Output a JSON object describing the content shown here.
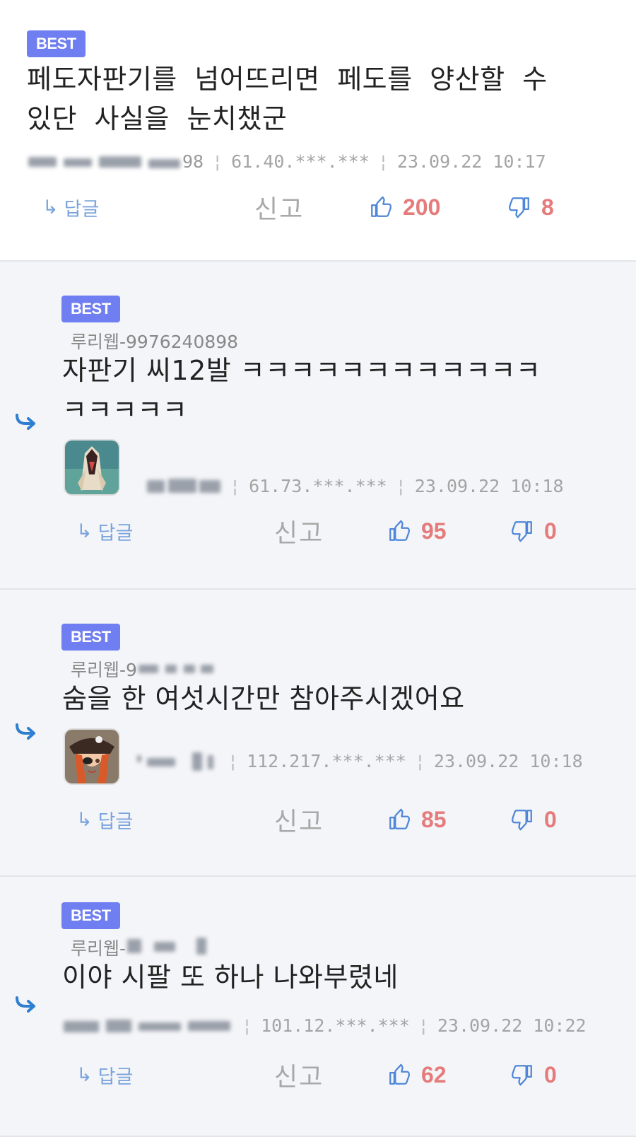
{
  "comments": [
    {
      "badge": "BEST",
      "text_lines": [
        "페도자판기를 넘어뜨리면 페도를 양산할 수",
        "있단 사실을 눈치챘군"
      ],
      "nick_visible": "98",
      "ip": "61.40.***.***",
      "datetime": "23.09.22 10:17",
      "reply_label": "답글",
      "report_label": "신고",
      "likes": "200",
      "dislikes": "8"
    },
    {
      "badge": "BEST",
      "nick": "루리웹-9976240898",
      "text_lines": [
        "자판기 씨12발 ㅋㅋㅋㅋㅋㅋㅋㅋㅋㅋㅋㅋ",
        "ㅋㅋㅋㅋㅋ"
      ],
      "ip": "61.73.***.***",
      "datetime": "23.09.22 10:18",
      "reply_label": "답글",
      "report_label": "신고",
      "likes": "95",
      "dislikes": "0"
    },
    {
      "badge": "BEST",
      "nick": "루리웹-9",
      "text_lines": [
        "숨을 한 여섯시간만 참아주시겠어요"
      ],
      "ip": "112.217.***.***",
      "datetime": "23.09.22 10:18",
      "reply_label": "답글",
      "report_label": "신고",
      "likes": "85",
      "dislikes": "0"
    },
    {
      "badge": "BEST",
      "nick": "루리웹-",
      "text_lines": [
        "이야 시팔 또 하나 나와부렸네"
      ],
      "ip": "101.12.***.***",
      "datetime": "23.09.22 10:22",
      "reply_label": "답글",
      "report_label": "신고",
      "likes": "62",
      "dislikes": "0"
    }
  ],
  "colors": {
    "badge": "#6f7ef0",
    "reply_link": "#7ba4dc",
    "vote_count": "#e57b7b",
    "reply_arrow": "#2f7fd0",
    "reply_bg": "#f4f5f8"
  },
  "icons": [
    "reply-arrow-icon",
    "thumbs-up-icon",
    "thumbs-down-icon",
    "reply-indent-arrow-icon"
  ]
}
